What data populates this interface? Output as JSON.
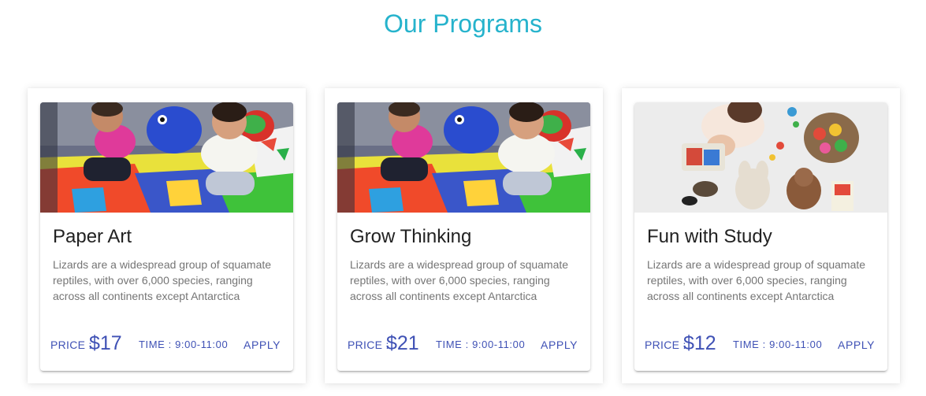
{
  "page": {
    "title": "Our Programs",
    "title_color": "#26b3cc",
    "accent_color": "#3f51b5"
  },
  "programs": [
    {
      "title": "Paper Art",
      "description": "Lizards are a widespread group of squamate reptiles, with over 6,000 species, ranging across all continents except Antarctica",
      "price_label": "PRICE :",
      "price": "$17",
      "time": "TIME : 9:00-11:00",
      "apply_label": "APPLY",
      "image": "children-playing-on-foam-mat-photo"
    },
    {
      "title": "Grow Thinking",
      "description": "Lizards are a widespread group of squamate reptiles, with over 6,000 species, ranging across all continents except Antarctica",
      "price_label": "PRICE :",
      "price": "$21",
      "time": "TIME : 9:00-11:00",
      "apply_label": "APPLY",
      "image": "children-playing-on-foam-mat-photo"
    },
    {
      "title": "Fun with Study",
      "description": "Lizards are a widespread group of squamate reptiles, with over 6,000 species, ranging across all continents except Antarctica",
      "price_label": "PRICE :",
      "price": "$12",
      "time": "TIME : 9:00-11:00",
      "apply_label": "APPLY",
      "image": "toddler-with-toys-overhead-photo"
    }
  ]
}
